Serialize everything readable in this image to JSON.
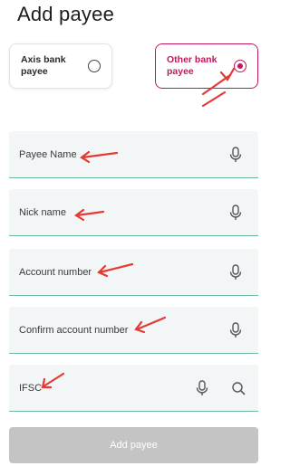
{
  "page": {
    "title": "Add payee"
  },
  "payee_type": {
    "axis": {
      "label_line1": "Axis bank",
      "label_line2": "payee",
      "selected": false
    },
    "other": {
      "label_line1": "Other bank",
      "label_line2": "payee",
      "selected": true
    }
  },
  "fields": {
    "payee_name": {
      "placeholder": "Payee Name",
      "icon": "microphone-icon"
    },
    "nick_name": {
      "placeholder": "Nick name",
      "icon": "microphone-icon"
    },
    "account_number": {
      "placeholder": "Account number",
      "icon": "microphone-icon"
    },
    "confirm_account_number": {
      "placeholder": "Confirm account number",
      "icon": "microphone-icon"
    },
    "ifsc": {
      "placeholder": "IFSC",
      "icons": [
        "microphone-icon",
        "search-icon"
      ]
    }
  },
  "actions": {
    "add_payee_label": "Add payee"
  },
  "colors": {
    "accent": "#c2185b",
    "annotation_arrow": "#e53935",
    "field_underline": "#6fb5a4",
    "disabled_button": "#c4c4c4"
  }
}
